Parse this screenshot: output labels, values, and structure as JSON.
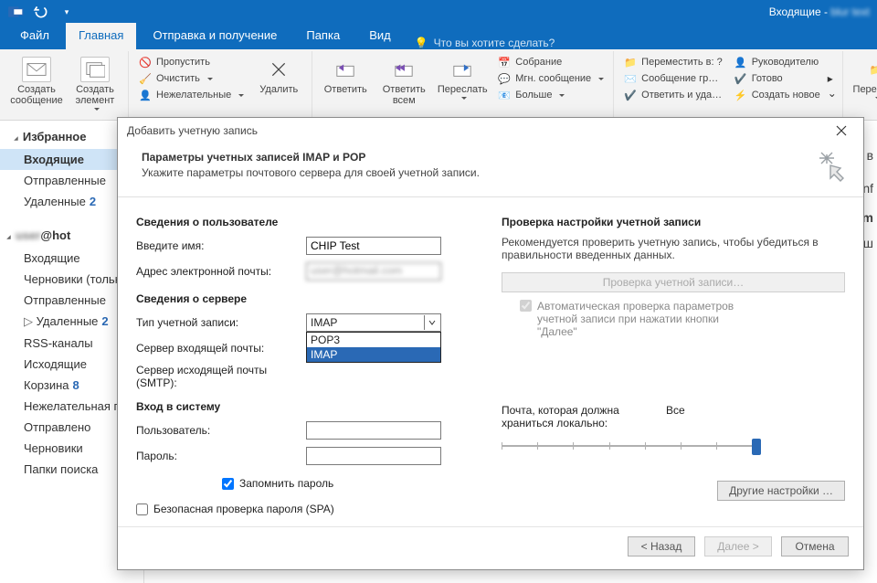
{
  "titlebar": {
    "inbox_prefix": "Входящие -",
    "account_blur": "blur text"
  },
  "tabs": {
    "file": "Файл",
    "home": "Главная",
    "send_receive": "Отправка и получение",
    "folder": "Папка",
    "view": "Вид",
    "tellme": "Что вы хотите сделать?"
  },
  "ribbon": {
    "new_mail": "Создать сообщение",
    "new_item": "Создать элемент",
    "ignore": "Пропустить",
    "clean": "Очистить",
    "junk": "Нежелательные",
    "delete": "Удалить",
    "reply": "Ответить",
    "reply_all": "Ответить всем",
    "forward": "Переслать",
    "meeting": "Собрание",
    "im": "Мгн. сообщение",
    "more": "Больше",
    "move_to": "Переместить в: ?",
    "team_msg": "Сообщение гр…",
    "reply_delete": "Ответить и уда…",
    "to_manager": "Руководителю",
    "done": "Готово",
    "create_new": "Создать новое",
    "move": "Перемест"
  },
  "sidebar": {
    "fav_header": "Избранное",
    "inbox": "Входящие",
    "sent": "Отправленные",
    "deleted": "Удаленные",
    "deleted_count": "2",
    "acct_blur": "user",
    "acct_suffix": "@hot",
    "a_inbox": "Входящие",
    "a_drafts": "Черновики (только",
    "a_sent": "Отправленные",
    "a_deleted": "Удаленные",
    "a_deleted_count": "2",
    "a_rss": "RSS-каналы",
    "a_outbox": "Исходящие",
    "a_trash": "Корзина",
    "a_trash_count": "8",
    "a_junk": "Нежелательная по",
    "a_sent2": "Отправлено",
    "a_drafts2": "Черновики",
    "a_search": "Папки поиска"
  },
  "dialog": {
    "title": "Добавить учетную запись",
    "heading": "Параметры учетных записей IMAP и POP",
    "subheading": "Укажите параметры почтового сервера для своей учетной записи.",
    "user_section": "Сведения о пользователе",
    "name_label": "Введите имя:",
    "name_value": "CHIP Test",
    "email_label": "Адрес электронной почты:",
    "email_value": "user@hotmail.com",
    "server_section": "Сведения о сервере",
    "acct_type_label": "Тип учетной записи:",
    "acct_type_value": "IMAP",
    "opt_pop3": "POP3",
    "opt_imap": "IMAP",
    "incoming_label": "Сервер входящей почты:",
    "outgoing_label": "Сервер исходящей почты (SMTP):",
    "login_section": "Вход в систему",
    "user_label": "Пользователь:",
    "pass_label": "Пароль:",
    "remember_pass": "Запомнить пароль",
    "spa": "Безопасная проверка пароля (SPA)",
    "test_heading": "Проверка настройки учетной записи",
    "test_desc": "Рекомендуется проверить учетную запись, чтобы убедиться в правильности введенных данных.",
    "test_btn": "Проверка учетной записи…",
    "auto_test": "Автоматическая проверка параметров учетной записи при нажатии кнопки \"Далее\"",
    "mail_local_label": "Почта, которая должна храниться локально:",
    "mail_local_value": "Все",
    "other_settings": "Другие настройки …",
    "back": "< Назад",
    "next": "Далее >",
    "cancel": "Отмена"
  }
}
